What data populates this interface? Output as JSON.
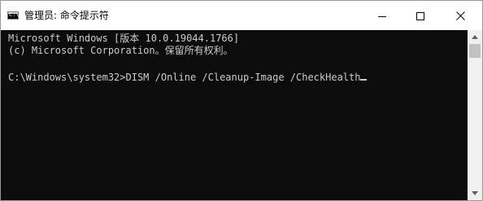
{
  "window": {
    "title": "管理员: 命令提示符",
    "icon": "cmd-console-icon"
  },
  "caption_buttons": {
    "minimize_icon": "minimize-icon",
    "maximize_icon": "maximize-icon",
    "close_icon": "close-icon"
  },
  "console": {
    "lines": [
      "Microsoft Windows [版本 10.0.19044.1766]",
      "(c) Microsoft Corporation。保留所有权利。",
      "",
      "C:\\Windows\\system32>DISM /Online /Cleanup-Image /CheckHealth"
    ],
    "text_color": "#cccccc",
    "background_color": "#0c0c0c"
  },
  "scrollbar": {
    "up_icon": "scroll-up-arrow-icon",
    "down_icon": "scroll-down-arrow-icon"
  }
}
